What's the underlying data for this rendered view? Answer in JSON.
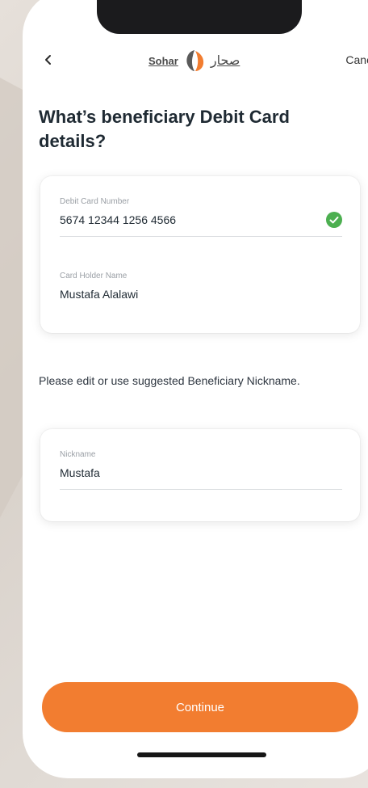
{
  "header": {
    "back_icon": "chevron-left-icon",
    "logo_text_en": "Sohar",
    "logo_text_ar": "صحار",
    "cancel_label": "Cancel"
  },
  "page": {
    "title": "What’s beneficiary Debit Card details?"
  },
  "card_details": {
    "debit_card_number_label": "Debit Card Number",
    "debit_card_number_value": "5674 12344 1256 4566",
    "verified_icon": "check-circle-icon",
    "card_holder_name_label": "Card Holder Name",
    "card_holder_name_value": "Mustafa Alalawi"
  },
  "nickname_hint": "Please edit or use suggested Beneficiary Nickname.",
  "nickname": {
    "label": "Nickname",
    "value": "Mustafa"
  },
  "actions": {
    "continue_label": "Continue"
  },
  "colors": {
    "accent": "#f27d30",
    "success": "#4caf50",
    "title_text": "#1f2a33"
  }
}
